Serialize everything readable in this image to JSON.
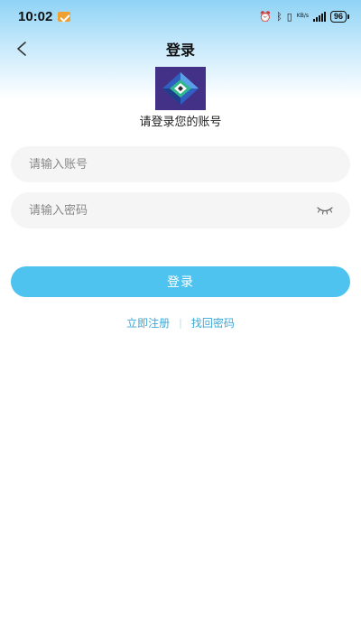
{
  "status_bar": {
    "time": "10:02",
    "battery": "96",
    "network_label": "KB/s"
  },
  "nav": {
    "title": "登录"
  },
  "subtitle": "请登录您的账号",
  "form": {
    "account_placeholder": "请输入账号",
    "password_placeholder": "请输入密码",
    "login_label": "登录"
  },
  "links": {
    "register": "立即注册",
    "separator": "|",
    "recover": "找回密码"
  },
  "colors": {
    "accent": "#4ec3f0",
    "link": "#3aa8d8",
    "field_bg": "#f5f5f5"
  }
}
